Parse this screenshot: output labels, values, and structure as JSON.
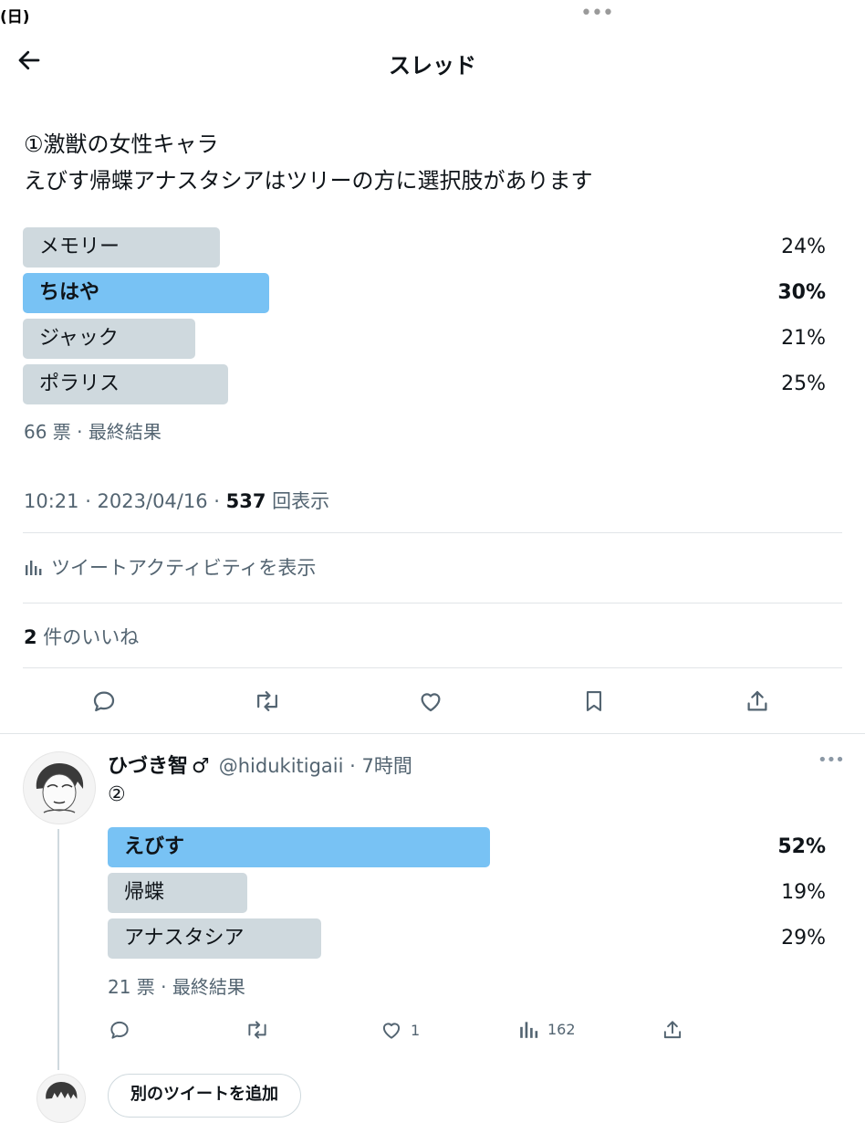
{
  "status_bar": {
    "left_text": "(日)"
  },
  "header": {
    "title": "スレッド"
  },
  "tweet": {
    "line1": "①激獣の女性キャラ",
    "line2": "えびす帰蝶アナスタシアはツリーの方に選択肢があります",
    "poll": [
      {
        "label": "メモリー",
        "percent": "24%",
        "value": 24,
        "winner": false
      },
      {
        "label": "ちはや",
        "percent": "30%",
        "value": 30,
        "winner": true
      },
      {
        "label": "ジャック",
        "percent": "21%",
        "value": 21,
        "winner": false
      },
      {
        "label": "ポラリス",
        "percent": "25%",
        "value": 25,
        "winner": false
      }
    ],
    "poll_summary": "66 票 · 最終結果",
    "timestamp": "10:21 · 2023/04/16 · ",
    "views_count": "537",
    "views_label": " 回表示",
    "activity_label": "ツイートアクティビティを表示",
    "likes_count": "2",
    "likes_label": " 件のいいね"
  },
  "reply": {
    "display_name": "ひづき智",
    "gender_symbol": "♂",
    "handle_time": "@hidukitigaii · 7時間",
    "text": "②",
    "poll": [
      {
        "label": "えびす",
        "percent": "52%",
        "value": 52,
        "winner": true
      },
      {
        "label": "帰蝶",
        "percent": "19%",
        "value": 19,
        "winner": false
      },
      {
        "label": "アナスタシア",
        "percent": "29%",
        "value": 29,
        "winner": false
      }
    ],
    "poll_summary": "21 票 · 最終結果",
    "like_count": "1",
    "view_count": "162"
  },
  "composer": {
    "add_tweet_label": "別のツイートを追加"
  },
  "colors": {
    "winner_bar": "#78c2f4",
    "bar": "#cfd9de",
    "muted_text": "#536471"
  }
}
